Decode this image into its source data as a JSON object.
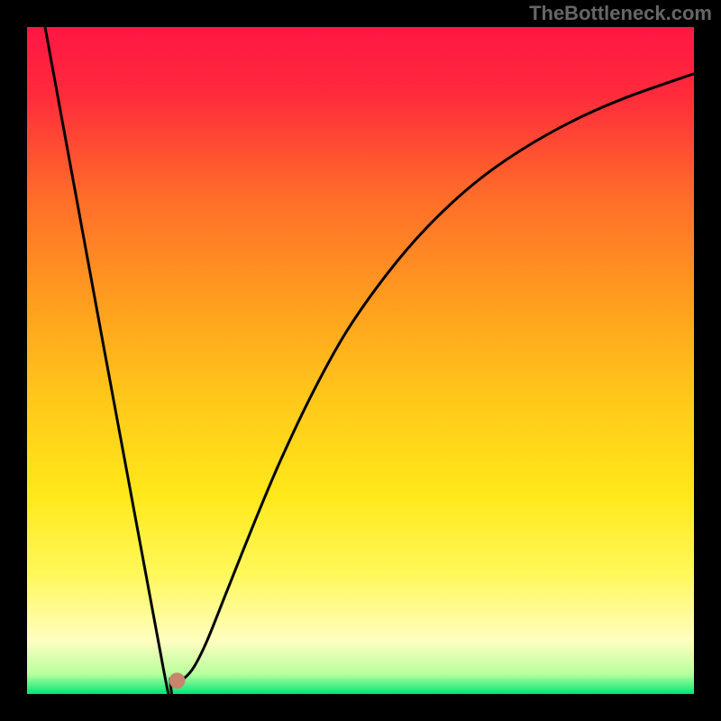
{
  "watermark": "TheBottleneck.com",
  "chart_data": {
    "type": "line",
    "title": "",
    "xlabel": "",
    "ylabel": "",
    "xlim": [
      0,
      100
    ],
    "ylim": [
      0,
      100
    ],
    "gradient_stops": [
      {
        "offset": 0,
        "color": "#ff1744"
      },
      {
        "offset": 10,
        "color": "#ff2a3c"
      },
      {
        "offset": 25,
        "color": "#ff6b2a"
      },
      {
        "offset": 40,
        "color": "#ff9a1f"
      },
      {
        "offset": 55,
        "color": "#ffc61a"
      },
      {
        "offset": 70,
        "color": "#ffe81a"
      },
      {
        "offset": 82,
        "color": "#fff85a"
      },
      {
        "offset": 92,
        "color": "#fffec0"
      },
      {
        "offset": 97,
        "color": "#b8ff9e"
      },
      {
        "offset": 100,
        "color": "#00e676"
      }
    ],
    "series": [
      {
        "name": "bottleneck-curve",
        "color": "#000000",
        "points": [
          {
            "x": 2.7,
            "y": 100
          },
          {
            "x": 20.5,
            "y": 3.5
          },
          {
            "x": 21.5,
            "y": 2.3
          },
          {
            "x": 22.5,
            "y": 2.0
          },
          {
            "x": 23.5,
            "y": 2.3
          },
          {
            "x": 25.0,
            "y": 4.0
          },
          {
            "x": 27.0,
            "y": 8.0
          },
          {
            "x": 30.0,
            "y": 15.5
          },
          {
            "x": 34.0,
            "y": 25.5
          },
          {
            "x": 38.0,
            "y": 35.0
          },
          {
            "x": 43.0,
            "y": 45.5
          },
          {
            "x": 48.0,
            "y": 54.5
          },
          {
            "x": 54.0,
            "y": 63.0
          },
          {
            "x": 60.0,
            "y": 70.0
          },
          {
            "x": 67.0,
            "y": 76.5
          },
          {
            "x": 74.0,
            "y": 81.5
          },
          {
            "x": 82.0,
            "y": 86.0
          },
          {
            "x": 90.0,
            "y": 89.5
          },
          {
            "x": 100.0,
            "y": 93.0
          }
        ]
      }
    ],
    "marker": {
      "x": 22.5,
      "y": 2.0,
      "color": "#c9856b",
      "radius": 1.2
    }
  }
}
